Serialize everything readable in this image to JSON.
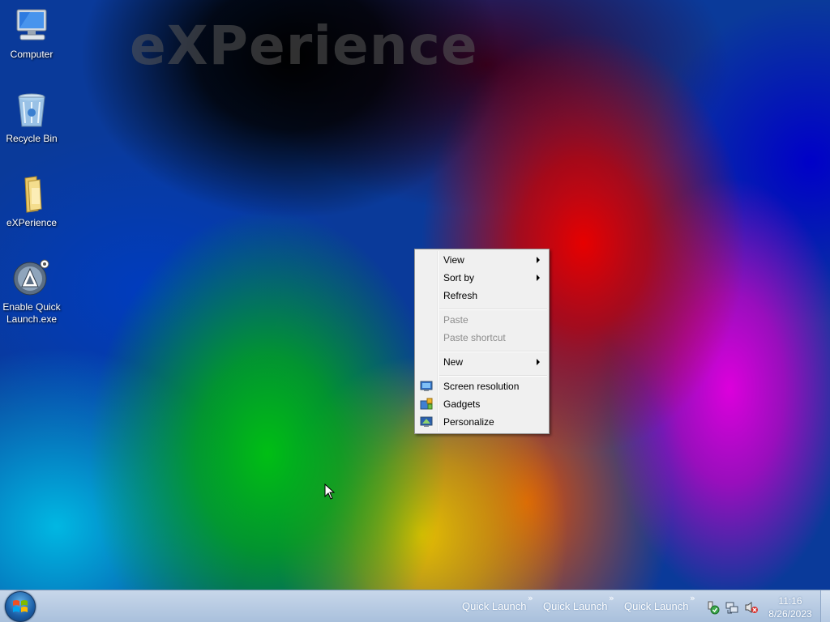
{
  "desktop": {
    "watermark": "eXPerience",
    "icons": [
      {
        "label": "Computer",
        "icon": "computer-icon"
      },
      {
        "label": "Recycle Bin",
        "icon": "recycle-bin-icon"
      },
      {
        "label": "eXPerience",
        "icon": "folder-icon"
      },
      {
        "label": "Enable Quick Launch.exe",
        "icon": "app-icon"
      }
    ]
  },
  "context_menu": {
    "items": [
      {
        "label": "View",
        "submenu": true,
        "enabled": true
      },
      {
        "label": "Sort by",
        "submenu": true,
        "enabled": true
      },
      {
        "label": "Refresh",
        "submenu": false,
        "enabled": true
      },
      {
        "label": "Paste",
        "submenu": false,
        "enabled": false
      },
      {
        "label": "Paste shortcut",
        "submenu": false,
        "enabled": false
      },
      {
        "label": "New",
        "submenu": true,
        "enabled": true
      },
      {
        "label": "Screen resolution",
        "icon": "screen-resolution-icon",
        "enabled": true
      },
      {
        "label": "Gadgets",
        "icon": "gadgets-icon",
        "enabled": true
      },
      {
        "label": "Personalize",
        "icon": "personalize-icon",
        "enabled": true
      }
    ]
  },
  "taskbar": {
    "start_icon": "windows-start-orb",
    "toolbars": [
      "Quick Launch",
      "Quick Launch",
      "Quick Launch"
    ],
    "chevron": "»",
    "tray_icons": [
      "action-center-icon",
      "network-icon",
      "volume-muted-icon"
    ],
    "clock": {
      "time": "11:16",
      "date": "8/26/2023"
    }
  }
}
